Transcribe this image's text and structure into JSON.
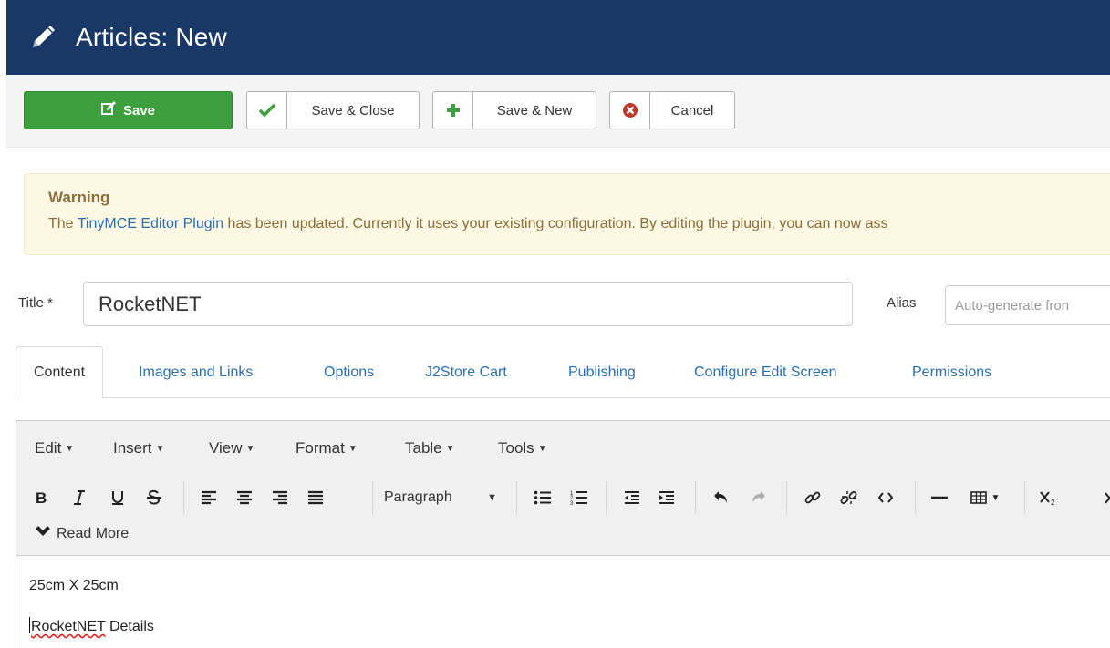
{
  "header": {
    "title": "Articles: New",
    "icon": "pencil-icon"
  },
  "toolbar": {
    "save_label": "Save",
    "save_close_label": "Save & Close",
    "save_new_label": "Save & New",
    "cancel_label": "Cancel"
  },
  "warning": {
    "heading": "Warning",
    "prefix": "The ",
    "link_text": "TinyMCE Editor Plugin",
    "suffix": " has been updated. Currently it uses your existing configuration. By editing the plugin, you can now ass"
  },
  "title_field": {
    "label": "Title *",
    "value": "RocketNET"
  },
  "alias_field": {
    "label": "Alias",
    "placeholder": "Auto-generate fron"
  },
  "tabs": [
    "Content",
    "Images and Links",
    "Options",
    "J2Store Cart",
    "Publishing",
    "Configure Edit Screen",
    "Permissions"
  ],
  "editor": {
    "menus": [
      "Edit",
      "Insert",
      "View",
      "Format",
      "Table",
      "Tools"
    ],
    "block_format": "Paragraph",
    "read_more_label": "Read More",
    "content": {
      "line1": "25cm X 25cm",
      "line2_word": "RocketNET",
      "line2_rest": " Details"
    }
  },
  "colors": {
    "header_bg": "#1a3867",
    "save_green": "#3d9f3d",
    "warning_bg": "#fcf8e3",
    "link_blue": "#2a6fb0"
  }
}
